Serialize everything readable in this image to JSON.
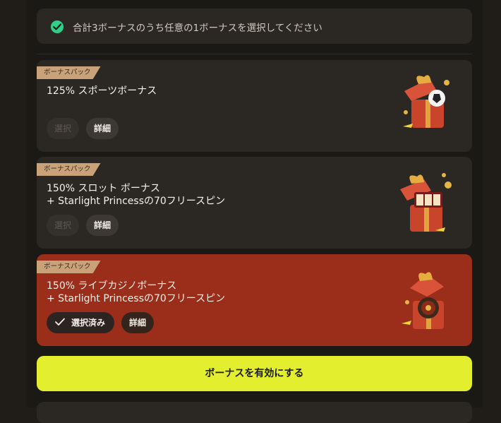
{
  "notice": {
    "text": "合計3ボーナスのうち任意の1ボーナスを選択してください"
  },
  "bonuses": [
    {
      "tag": "ボーナスパック",
      "title_line1": "125% スポーツボーナス",
      "title_line2": "",
      "select_label": "選択",
      "detail_label": "詳細",
      "icon": "gift-box-football-icon",
      "selected": false
    },
    {
      "tag": "ボーナスパック",
      "title_line1": "150% スロット ボーナス",
      "title_line2": "+ Starlight Princessの70フリースピン",
      "select_label": "選択",
      "detail_label": "詳細",
      "icon": "gift-box-slot-icon",
      "selected": false
    },
    {
      "tag": "ボーナスパック",
      "title_line1": "150% ライブカジノボーナス",
      "title_line2": "+ Starlight Princessの70フリースピン",
      "select_label": "選択済み",
      "detail_label": "詳細",
      "icon": "gift-box-roulette-icon",
      "selected": true
    }
  ],
  "cta": {
    "label": "ボーナスを有効にする"
  },
  "colors": {
    "accent": "#e3ee2f",
    "selected_card": "#9b2e1a",
    "check_green": "#2fd18a",
    "tag_bg": "#c9a27a"
  }
}
